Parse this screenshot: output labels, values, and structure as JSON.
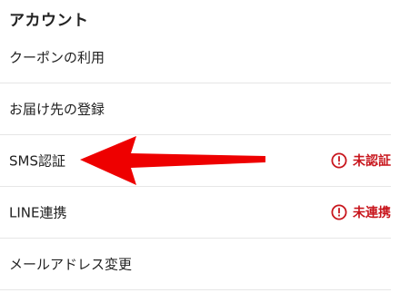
{
  "section": {
    "title": "アカウント"
  },
  "menu": {
    "items": [
      {
        "label": "クーポンの利用"
      },
      {
        "label": "お届け先の登録"
      },
      {
        "label": "SMS認証",
        "status": "未認証"
      },
      {
        "label": "LINE連携",
        "status": "未連携"
      },
      {
        "label": "メールアドレス変更"
      }
    ]
  },
  "colors": {
    "status_red": "#c8161d",
    "annotation_arrow": "#ee0000",
    "divider": "#e6e6e6"
  },
  "icons": {
    "status": "alert-circle-icon",
    "annotation": "pointer-arrow"
  }
}
